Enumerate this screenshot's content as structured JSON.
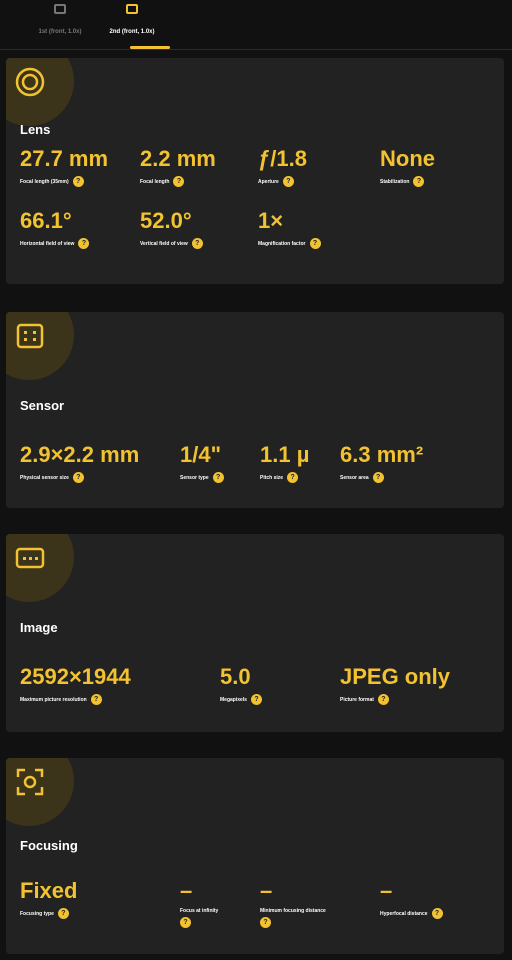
{
  "tabs": [
    {
      "label": "1st (front, 1.0x)",
      "active": false
    },
    {
      "label": "2nd (front, 1.0x)",
      "active": true
    }
  ],
  "sections": {
    "lens": {
      "title": "Lens",
      "icon": "lens-circle-icon",
      "specs": [
        {
          "value": "27.7 mm",
          "label": "Focal length (35mm)"
        },
        {
          "value": "2.2 mm",
          "label": "Focal length"
        },
        {
          "value": "ƒ/1.8",
          "label": "Aperture"
        },
        {
          "value": "None",
          "label": "Stabilization"
        },
        {
          "value": "66.1°",
          "label": "Horizontal field of view"
        },
        {
          "value": "52.0°",
          "label": "Vertical field of view"
        },
        {
          "value": "1×",
          "label": "Magnification factor"
        }
      ]
    },
    "sensor": {
      "title": "Sensor",
      "icon": "sensor-chip-icon",
      "specs": [
        {
          "value": "2.9×2.2 mm",
          "label": "Physical sensor size"
        },
        {
          "value": "1/4\"",
          "label": "Sensor type"
        },
        {
          "value": "1.1 µ",
          "label": "Pitch size"
        },
        {
          "value": "6.3 mm²",
          "label": "Sensor area"
        }
      ]
    },
    "image": {
      "title": "Image",
      "icon": "image-frame-icon",
      "specs": [
        {
          "value": "2592×1944",
          "label": "Maximum picture resolution"
        },
        {
          "value": "5.0",
          "label": "Megapixels"
        },
        {
          "value": "JPEG only",
          "label": "Picture format"
        }
      ]
    },
    "focusing": {
      "title": "Focusing",
      "icon": "focus-bracket-icon",
      "specs": [
        {
          "value": "Fixed",
          "label": "Focusing type"
        },
        {
          "value": "–",
          "label": "Focus at infinity"
        },
        {
          "value": "–",
          "label": "Minimum focusing distance"
        },
        {
          "value": "–",
          "label": "Hyperfocal distance"
        }
      ]
    }
  },
  "help_glyph": "?",
  "colors": {
    "accent": "#f2c230",
    "card": "#222222",
    "background": "#111111"
  }
}
